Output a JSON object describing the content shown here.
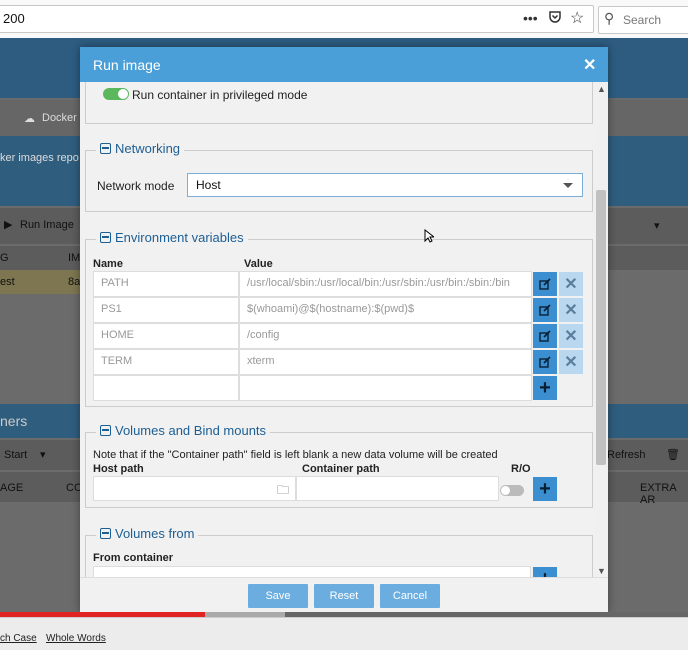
{
  "browser": {
    "url": "200",
    "search_placeholder": "Search"
  },
  "background": {
    "toolbar_docker": "Docker",
    "images_repo": "ker images repo",
    "run_image": "Run Image",
    "col_g": "G",
    "col_im": "IM",
    "row_name": "est",
    "row_id": "8a",
    "section": "ners",
    "start": "Start",
    "refresh": "Refresh",
    "col_age": "AGE",
    "col_co": "CO",
    "col_extra": "EXTRA AR"
  },
  "modal": {
    "title": "Run image",
    "privileged_label": "Run container in privileged mode",
    "networking": {
      "legend": "Networking",
      "mode_label": "Network mode",
      "mode_value": "Host"
    },
    "env": {
      "legend": "Environment variables",
      "col_name": "Name",
      "col_value": "Value",
      "rows": [
        {
          "name": "PATH",
          "value": "/usr/local/sbin:/usr/local/bin:/usr/sbin:/usr/bin:/sbin:/bin"
        },
        {
          "name": "PS1",
          "value": "$(whoami)@$(hostname):$(pwd)$"
        },
        {
          "name": "HOME",
          "value": "/config"
        },
        {
          "name": "TERM",
          "value": "xterm"
        }
      ]
    },
    "volumes": {
      "legend": "Volumes and Bind mounts",
      "note": "Note that if the \"Container path\" field is left blank a new data volume will be created",
      "host_path": "Host path",
      "container_path": "Container path",
      "ro": "R/O"
    },
    "volumes_from": {
      "legend": "Volumes from",
      "from_container": "From container"
    },
    "footer": {
      "save": "Save",
      "reset": "Reset",
      "cancel": "Cancel"
    }
  },
  "findbar": {
    "match_case": "ch Case",
    "whole_words": "Whole Words"
  },
  "colors": {
    "accent": "#4a9fd8",
    "button": "#3b8fd0",
    "toggle_on": "#5cb85c"
  }
}
